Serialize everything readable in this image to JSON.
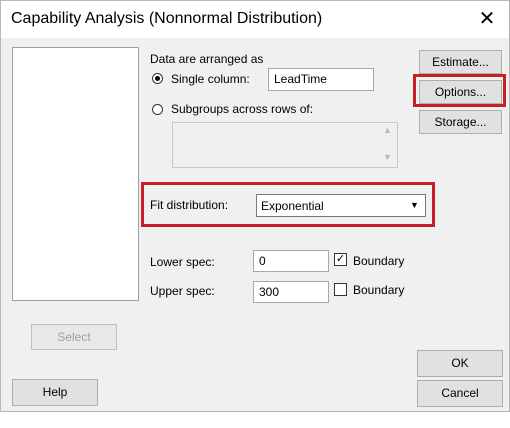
{
  "window": {
    "title": "Capability Analysis (Nonnormal Distribution)",
    "close_glyph": "✕"
  },
  "data_arrangement": {
    "heading": "Data are arranged as",
    "single_column": {
      "label": "Single column:",
      "selected": true,
      "value": "LeadTime"
    },
    "subgroups": {
      "label": "Subgroups across rows of:",
      "selected": false,
      "value": ""
    }
  },
  "fit_distribution": {
    "label": "Fit distribution:",
    "value": "Exponential"
  },
  "specs": {
    "lower": {
      "label": "Lower spec:",
      "value": "0",
      "boundary_label": "Boundary",
      "boundary_checked": true
    },
    "upper": {
      "label": "Upper spec:",
      "value": "300",
      "boundary_label": "Boundary",
      "boundary_checked": false
    }
  },
  "buttons": {
    "estimate": "Estimate...",
    "options": "Options...",
    "storage": "Storage...",
    "select": "Select",
    "help": "Help",
    "ok": "OK",
    "cancel": "Cancel"
  },
  "glyphs": {
    "check_mark": "✓",
    "dropdown_arrow": "▼",
    "scroll_up": "▲",
    "scroll_down": "▼"
  },
  "colors": {
    "highlight": "#c42026",
    "dialog_bg": "#f0f0f0"
  }
}
